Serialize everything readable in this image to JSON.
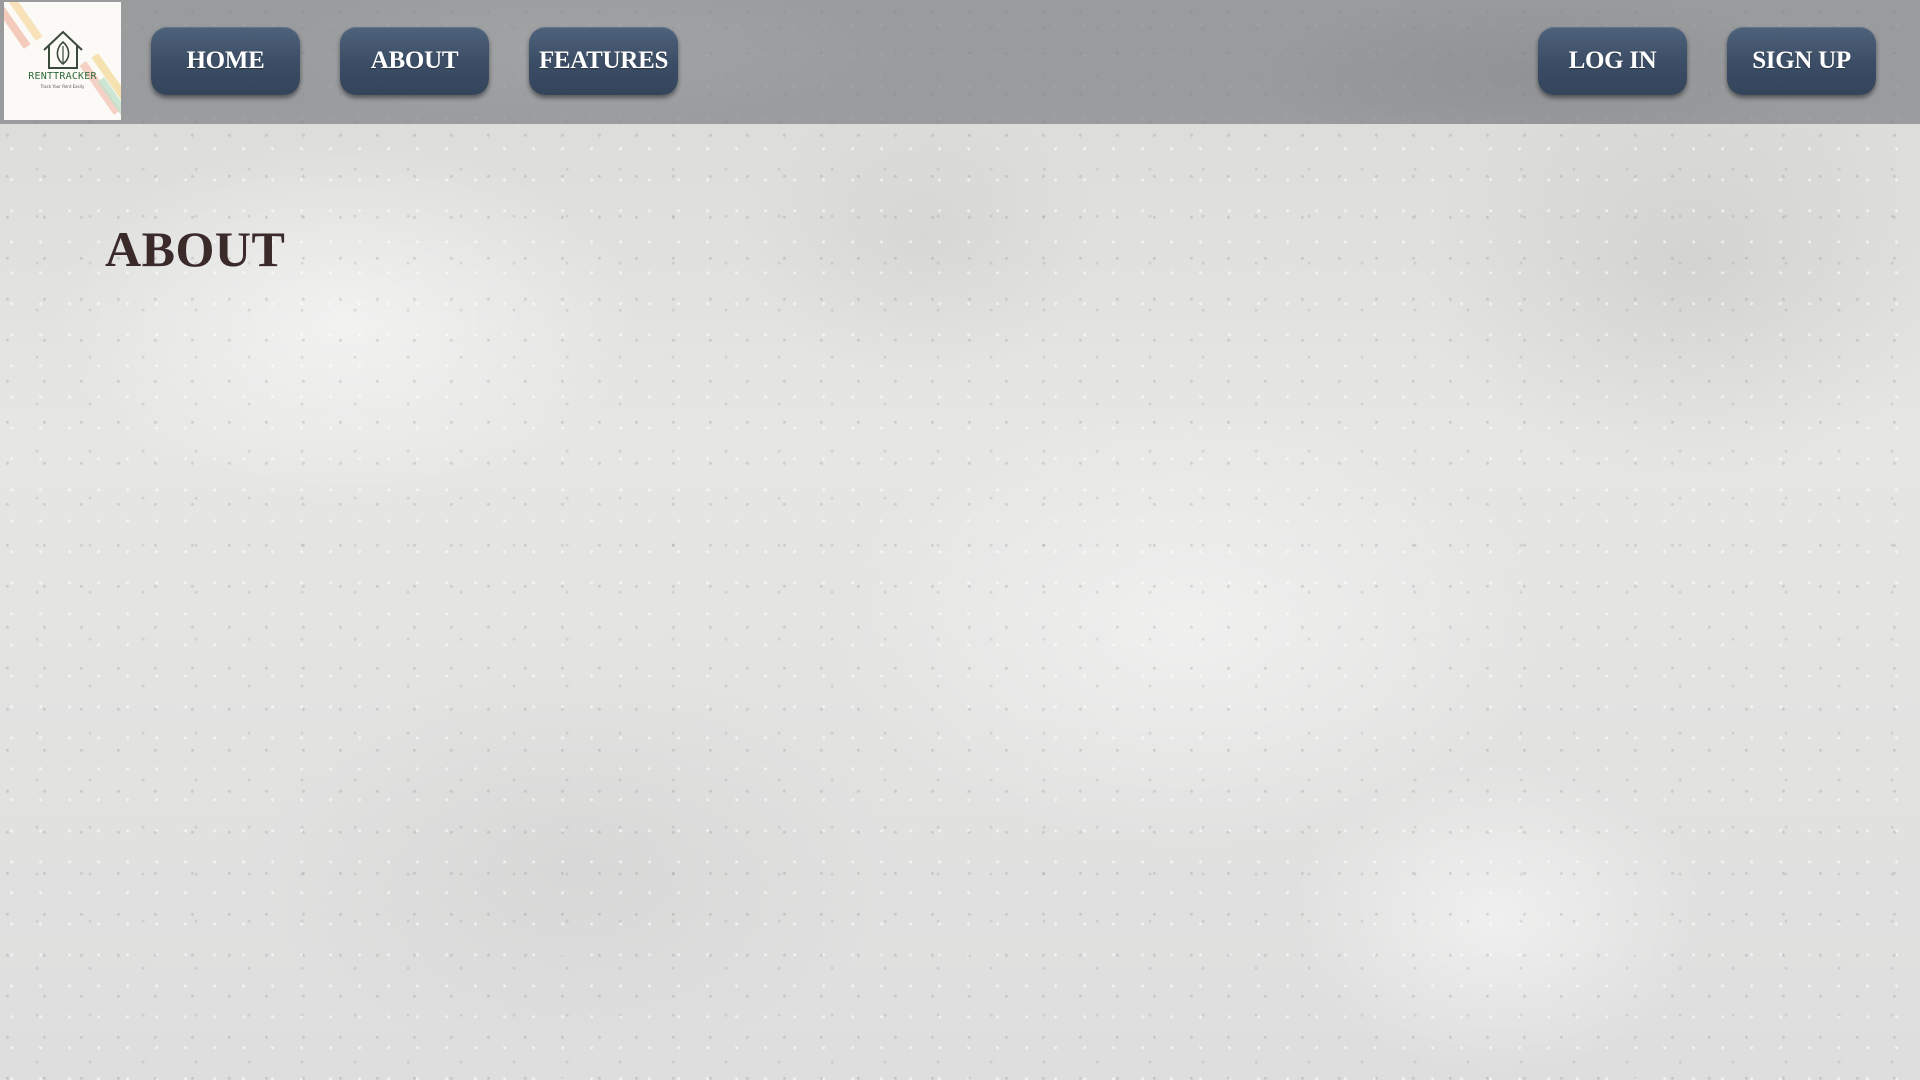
{
  "header": {
    "logo": {
      "brand_text": "RENTTRACKER",
      "tagline": "Track Your Rent Easily"
    },
    "nav": {
      "home_label": "HOME",
      "about_label": "ABOUT",
      "features_label": "FEATURES"
    },
    "auth": {
      "login_label": "LOG IN",
      "signup_label": "SIGN UP"
    }
  },
  "main": {
    "title": "ABOUT"
  },
  "colors": {
    "button_bg": "#3b4d65",
    "navbar_bg": "#808286",
    "title_text": "#3a2a2a",
    "logo_green": "#2f6a3a"
  }
}
